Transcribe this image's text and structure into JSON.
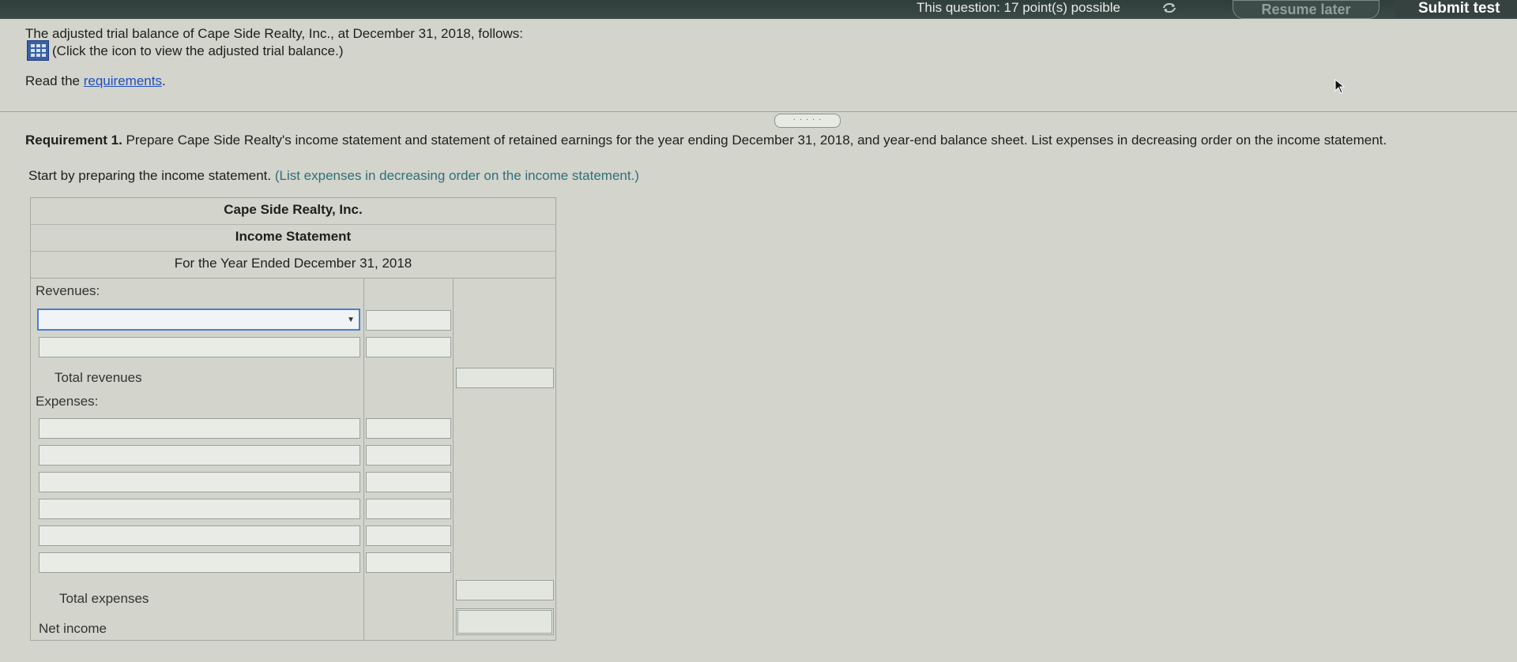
{
  "topbar": {
    "points_text": "This question: 17 point(s) possible",
    "resume_label": "Resume later",
    "submit_label": "Submit test"
  },
  "question": {
    "intro": "The adjusted trial balance of Cape Side Realty, Inc., at December 31, 2018, follows:",
    "click_text": "(Click the icon to view the adjusted trial balance.)",
    "read_prefix": "Read the ",
    "requirements_link": "requirements",
    "read_suffix": ".",
    "expand_label": "· · · · ·"
  },
  "requirement": {
    "label": "Requirement 1.",
    "text": " Prepare Cape Side Realty's income statement and statement of retained earnings for the year ending December 31, 2018, and year-end balance sheet. List expenses in decreasing order on the income statement.",
    "start_prefix": "Start by preparing the income statement. ",
    "start_note": "(List expenses in decreasing order on the income statement.)"
  },
  "statement": {
    "company": "Cape Side Realty, Inc.",
    "title": "Income Statement",
    "period": "For the Year Ended December 31, 2018",
    "revenues_label": "Revenues:",
    "total_revenues_label": "Total revenues",
    "expenses_label": "Expenses:",
    "total_expenses_label": "Total expenses",
    "net_income_label": "Net income",
    "revenue_dropdown_value": "",
    "expense_rows": 6
  }
}
